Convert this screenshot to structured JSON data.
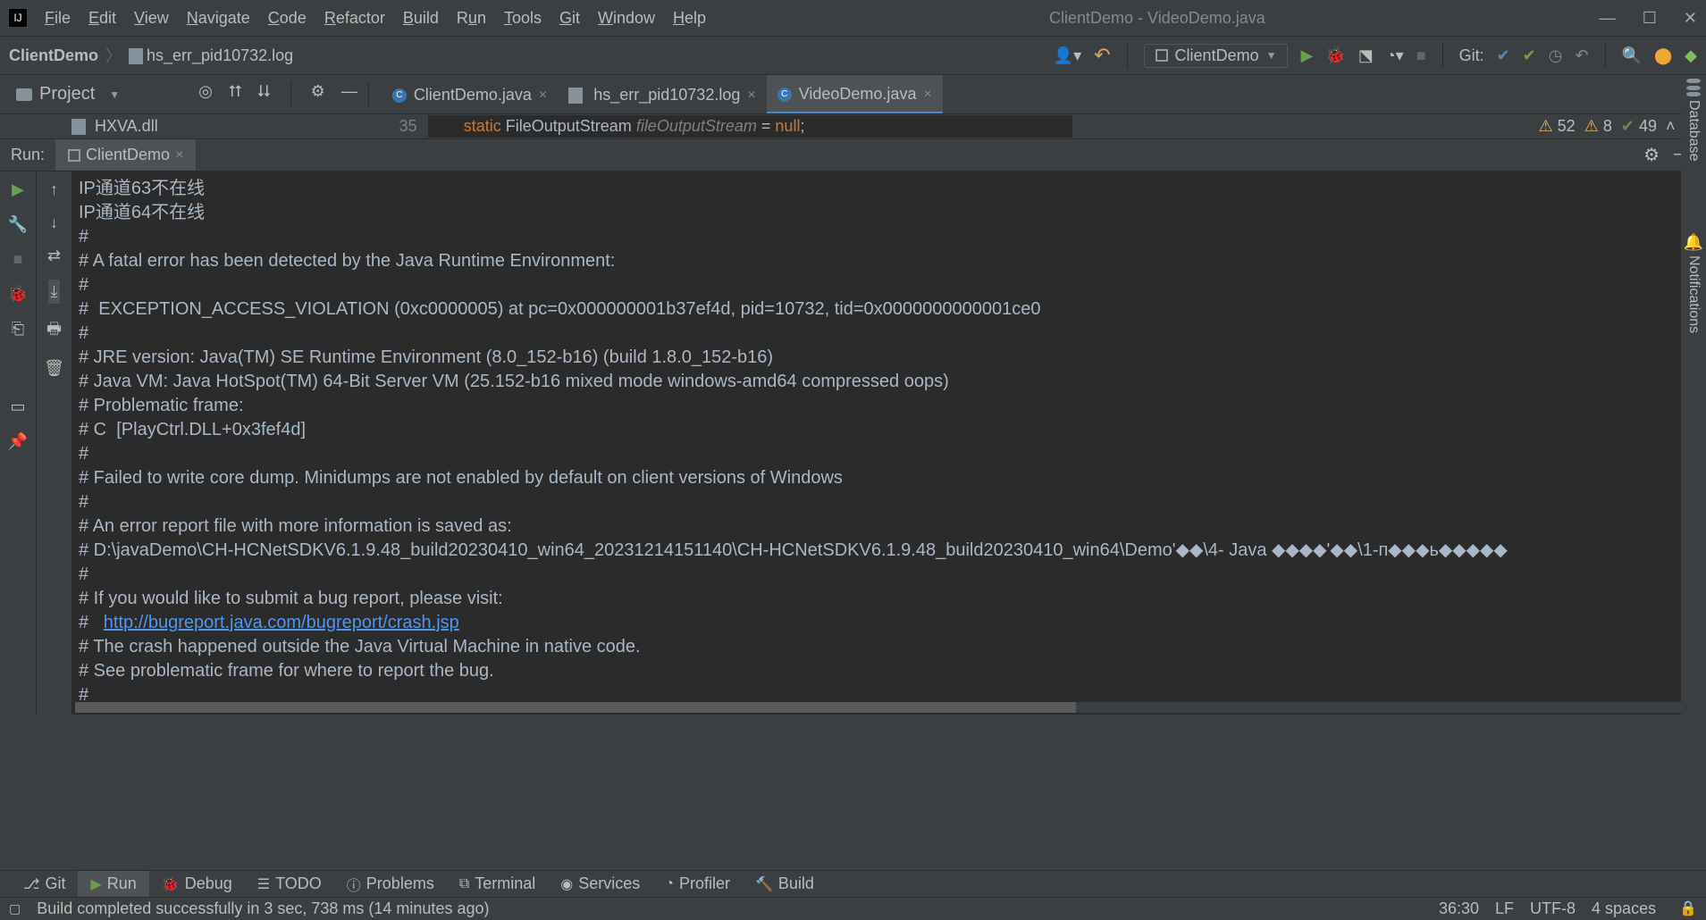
{
  "menubar": [
    "File",
    "Edit",
    "View",
    "Navigate",
    "Code",
    "Refactor",
    "Build",
    "Run",
    "Tools",
    "Git",
    "Window",
    "Help"
  ],
  "app_title": "ClientDemo - VideoDemo.java",
  "breadcrumb": {
    "project": "ClientDemo",
    "file": "hs_err_pid10732.log"
  },
  "run_config": "ClientDemo",
  "git_label": "Git:",
  "project_panel_label": "Project",
  "project_file": "HXVA.dll",
  "editor_tabs": [
    {
      "name": "ClientDemo.java",
      "icon": "J",
      "active": false
    },
    {
      "name": "hs_err_pid10732.log",
      "icon": "file",
      "active": false
    },
    {
      "name": "VideoDemo.java",
      "icon": "J",
      "active": true
    }
  ],
  "code_line_num": "35",
  "code_snippet": {
    "kw": "static",
    "cls": "FileOutputStream",
    "var": "fileOutputStream",
    "op": "=",
    "val": "null",
    "end": ";"
  },
  "inspection_badges": {
    "warn_count": "52",
    "err_count": "8",
    "ok_count": "49"
  },
  "run_label": "Run:",
  "run_tab": "ClientDemo",
  "console_lines": [
    "IP通道63不在线",
    "IP通道64不在线",
    "#",
    "# A fatal error has been detected by the Java Runtime Environment:",
    "#",
    "#  EXCEPTION_ACCESS_VIOLATION (0xc0000005) at pc=0x000000001b37ef4d, pid=10732, tid=0x0000000000001ce0",
    "#",
    "# JRE version: Java(TM) SE Runtime Environment (8.0_152-b16) (build 1.8.0_152-b16)",
    "# Java VM: Java HotSpot(TM) 64-Bit Server VM (25.152-b16 mixed mode windows-amd64 compressed oops)",
    "# Problematic frame:",
    "# C  [PlayCtrl.DLL+0x3fef4d]",
    "#",
    "# Failed to write core dump. Minidumps are not enabled by default on client versions of Windows",
    "#",
    "# An error report file with more information is saved as:",
    "# D:\\javaDemo\\CH-HCNetSDKV6.1.9.48_build20230410_win64_20231214151140\\CH-HCNetSDKV6.1.9.48_build20230410_win64\\Demo'◆◆\\4- Java ◆◆◆◆'◆◆\\1-п◆◆◆ь◆◆◆◆◆",
    "#",
    "# If you would like to submit a bug report, please visit:",
    "#   ",
    "# The crash happened outside the Java Virtual Machine in native code.",
    "# See problematic frame for where to report the bug.",
    "#"
  ],
  "bugreport_url": "http://bugreport.java.com/bugreport/crash.jsp",
  "bottom_tabs": [
    "Git",
    "Run",
    "Debug",
    "TODO",
    "Problems",
    "Terminal",
    "Services",
    "Profiler",
    "Build"
  ],
  "status_message": "Build completed successfully in 3 sec, 738 ms (14 minutes ago)",
  "status_right": {
    "pos": "36:30",
    "le": "LF",
    "enc": "UTF-8",
    "indent": "4 spaces"
  },
  "right_panels": [
    "Database",
    "Notifications"
  ]
}
